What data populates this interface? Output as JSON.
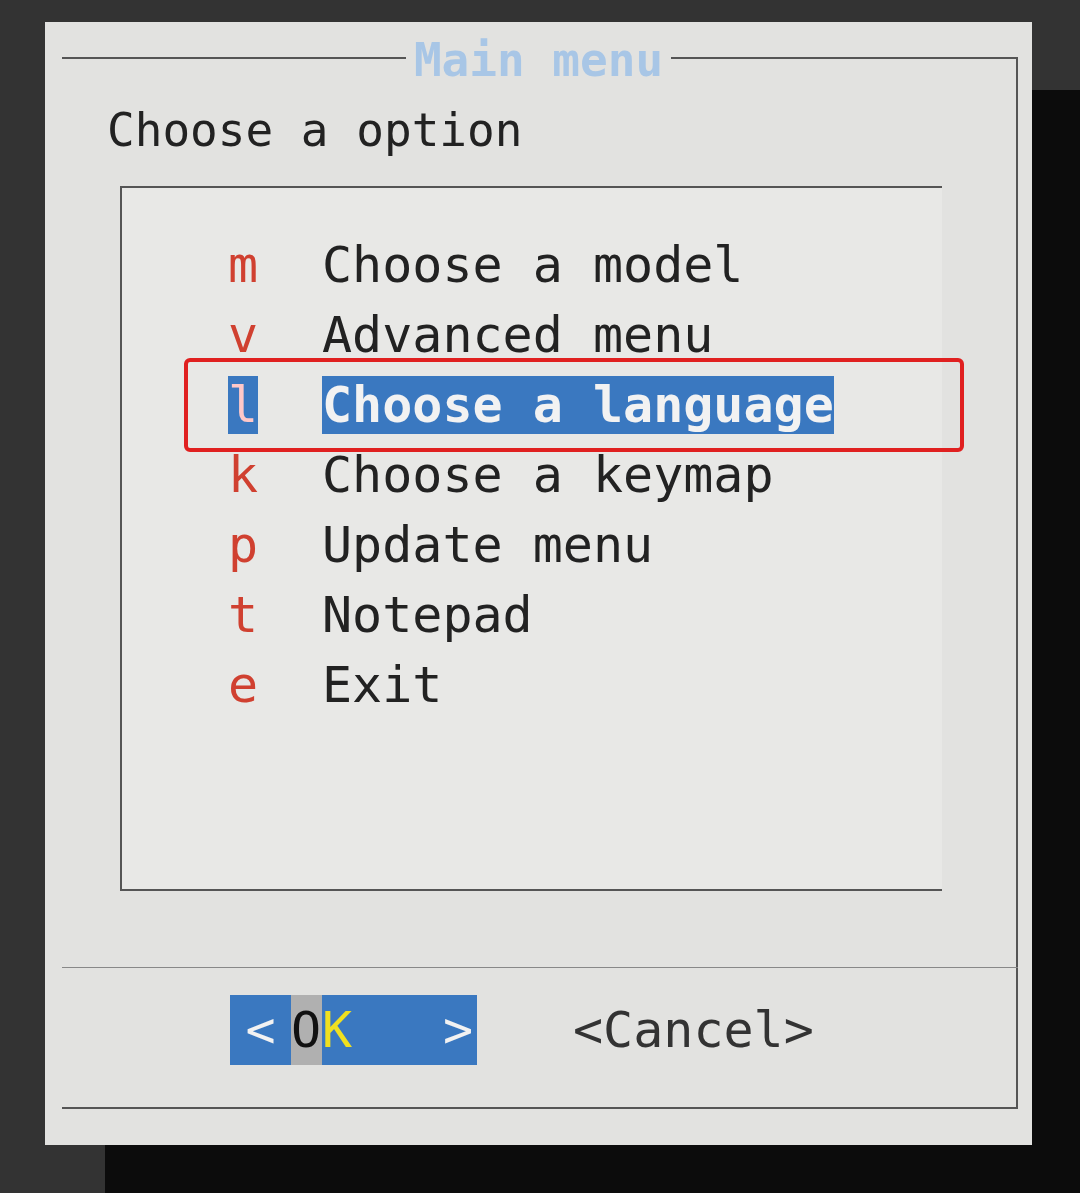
{
  "dialog": {
    "title": "Main menu",
    "prompt": "Choose a option"
  },
  "highlight_box": true,
  "items": [
    {
      "hotkey": "m",
      "label": "Choose a model",
      "selected": false
    },
    {
      "hotkey": "v",
      "label": "Advanced menu",
      "selected": false
    },
    {
      "hotkey": "l",
      "label": "Choose a language",
      "selected": true
    },
    {
      "hotkey": "k",
      "label": "Choose a keymap",
      "selected": false
    },
    {
      "hotkey": "p",
      "label": "Update menu",
      "selected": false
    },
    {
      "hotkey": "t",
      "label": "Notepad",
      "selected": false
    },
    {
      "hotkey": "e",
      "label": "Exit",
      "selected": false
    }
  ],
  "buttons": [
    {
      "left": "<",
      "label": "OK",
      "right": ">",
      "selected": true
    },
    {
      "left": "<",
      "label": "Cancel",
      "right": ">",
      "selected": false
    }
  ]
}
